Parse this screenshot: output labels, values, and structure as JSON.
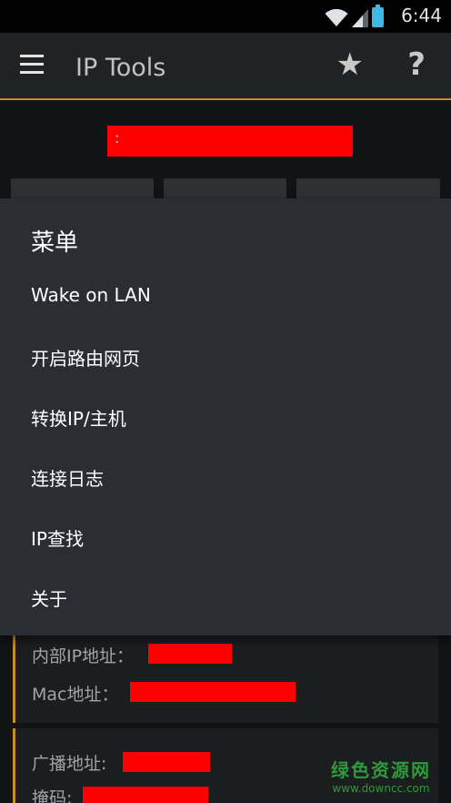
{
  "status_bar": {
    "time": "6:44",
    "icons": [
      "wifi-icon",
      "signal-icon",
      "battery-icon"
    ]
  },
  "app_bar": {
    "title": "IP Tools",
    "left_icon": "menu-icon",
    "right_icons": [
      "star-icon",
      "help-icon"
    ]
  },
  "menu": {
    "title": "菜单",
    "items": [
      {
        "label": "Wake on LAN"
      },
      {
        "label": "开启路由网页"
      },
      {
        "label": "转换IP/主机"
      },
      {
        "label": "连接日志"
      },
      {
        "label": "IP查找"
      },
      {
        "label": "关于"
      }
    ]
  },
  "info": {
    "internal_ip_label": "内部IP地址：",
    "mac_label": "Mac地址：",
    "broadcast_label": "广播地址:",
    "mask_label": "掩码:"
  },
  "watermark": {
    "main": "绿色资源网",
    "sub": "www.downcc.com"
  },
  "colors": {
    "accent": "#c38d2a",
    "redaction": "#ff0000",
    "menu_bg": "#2a2e34",
    "watermark": "#2e9a3c"
  }
}
